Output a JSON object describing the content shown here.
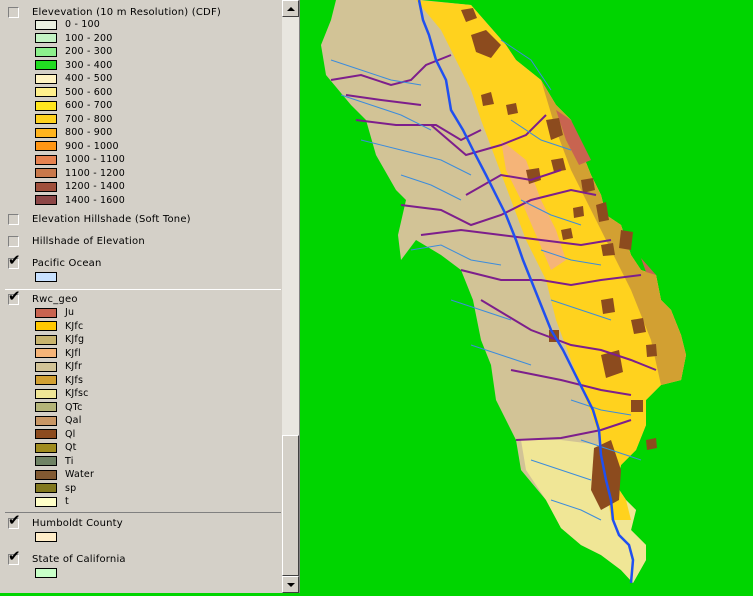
{
  "toc": {
    "layers": [
      {
        "name": "Elevevation (10 m Resolution) (CDF)",
        "checked": false,
        "legend": [
          {
            "label": "0 - 100",
            "color": "#eaf0e0"
          },
          {
            "label": "100 - 200",
            "color": "#c4f4c4"
          },
          {
            "label": "200 - 300",
            "color": "#8cf08c"
          },
          {
            "label": "300 - 400",
            "color": "#22dc22"
          },
          {
            "label": "400 - 500",
            "color": "#fff4c2"
          },
          {
            "label": "500 - 600",
            "color": "#fff08c"
          },
          {
            "label": "600 - 700",
            "color": "#ffe61e"
          },
          {
            "label": "700 - 800",
            "color": "#ffd21e"
          },
          {
            "label": "800 - 900",
            "color": "#ffb41e"
          },
          {
            "label": "900 - 1000",
            "color": "#ff9614"
          },
          {
            "label": "1000 - 1100",
            "color": "#e68250"
          },
          {
            "label": "1100 - 1200",
            "color": "#c8784b"
          },
          {
            "label": "1200 - 1400",
            "color": "#a0503c"
          },
          {
            "label": "1400 - 1600",
            "color": "#8c4646"
          }
        ]
      },
      {
        "name": "Elevation Hillshade (Soft Tone)",
        "checked": false,
        "legend": []
      },
      {
        "name": "Hillshade of Elevation",
        "checked": false,
        "legend": []
      },
      {
        "name": "Pacific Ocean",
        "checked": true,
        "legend": [
          {
            "label": "",
            "color": "#c8e1ff"
          }
        ]
      },
      {
        "name": "Rwc_geo",
        "checked": true,
        "legend": [
          {
            "label": "Ju",
            "color": "#c86450"
          },
          {
            "label": "KJfc",
            "color": "#ffc800"
          },
          {
            "label": "KJfg",
            "color": "#c8b46e"
          },
          {
            "label": "KJfl",
            "color": "#f5b478"
          },
          {
            "label": "KJfr",
            "color": "#d2c396"
          },
          {
            "label": "KJfs",
            "color": "#d2a032"
          },
          {
            "label": "KJfsc",
            "color": "#f0e696"
          },
          {
            "label": "QTc",
            "color": "#b4b478"
          },
          {
            "label": "Qal",
            "color": "#c89664"
          },
          {
            "label": "Ql",
            "color": "#8c4b1e"
          },
          {
            "label": "Qt",
            "color": "#a08c1e"
          },
          {
            "label": "Ti",
            "color": "#6e8264"
          },
          {
            "label": "Water",
            "color": "#825a32"
          },
          {
            "label": "sp",
            "color": "#82781e"
          },
          {
            "label": "t",
            "color": "#ffffc8"
          }
        ]
      },
      {
        "name": "Humboldt County",
        "checked": true,
        "legend": [
          {
            "label": "",
            "color": "#ffedc8"
          }
        ]
      },
      {
        "name": "State of California",
        "checked": true,
        "legend": [
          {
            "label": "",
            "color": "#c8ffc8"
          }
        ]
      }
    ]
  },
  "map": {
    "background_color": "#00d500",
    "river_color": "#2050f0",
    "stream_color": "#3c8cdc",
    "boundary_color": "#7d1e8c"
  }
}
